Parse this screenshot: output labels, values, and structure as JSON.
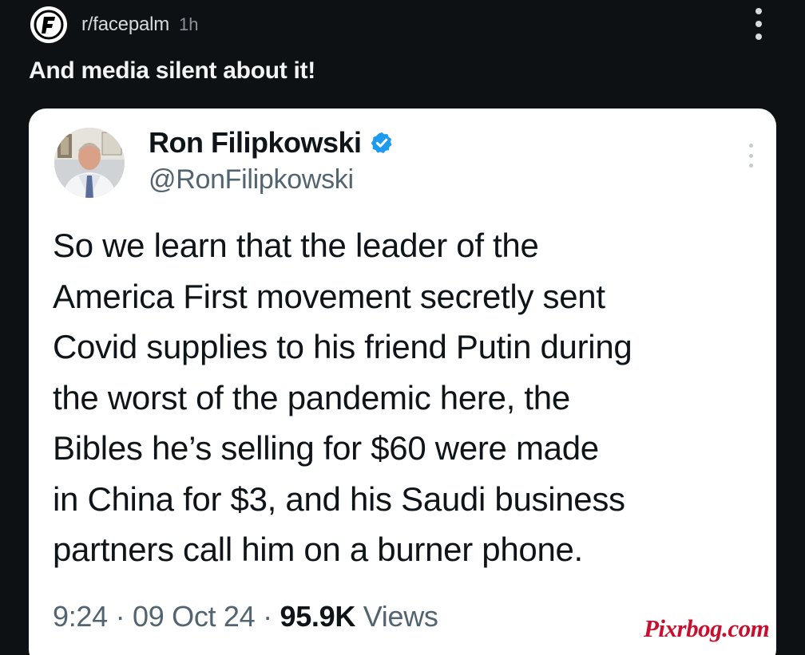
{
  "post": {
    "subreddit": "r/facepalm",
    "time": "1h",
    "title": "And media silent about it!"
  },
  "tweet": {
    "author_name": "Ron Filipkowski",
    "handle": "@RonFilipkowski",
    "verified": true,
    "text_lines": [
      "So we learn that the leader of the",
      "America First movement secretly sent",
      "Covid supplies to his friend Putin during",
      "the worst of the pandemic here, the",
      "Bibles he’s selling for $60 were made",
      "in China for $3, and his Saudi business",
      "partners call him on a burner phone."
    ],
    "time": "9:24",
    "separator": " · ",
    "date": "09 Oct 24",
    "views_count": "95.9K",
    "views_label": "Views"
  },
  "watermark": "Pixrbog.com",
  "icons": {
    "subreddit": "facepalm-subreddit-icon",
    "more": "more-vertical-icon",
    "verified": "verified-badge-icon"
  },
  "colors": {
    "background": "#0e1113",
    "verified_blue": "#1d9bf0",
    "watermark_red": "#c8102e"
  }
}
